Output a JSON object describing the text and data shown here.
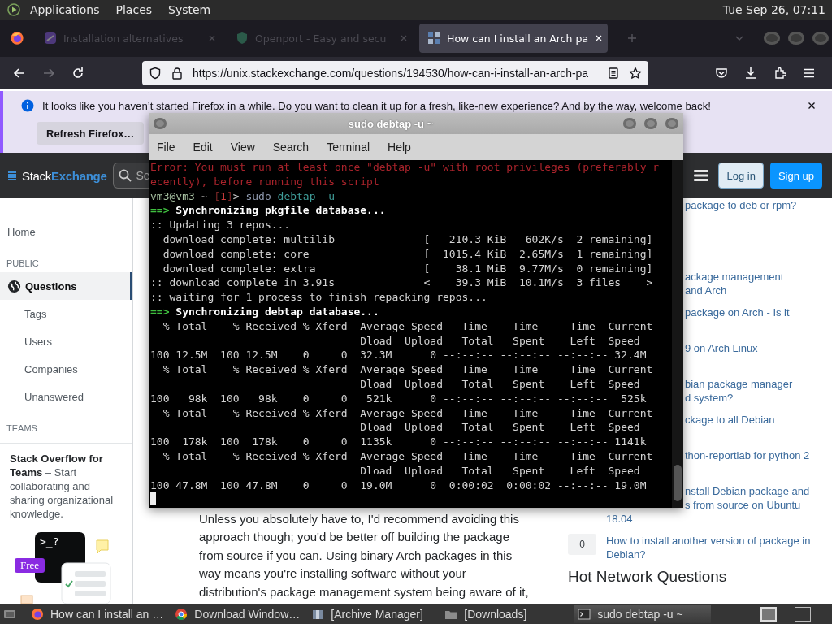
{
  "top_panel": {
    "menus": [
      "Applications",
      "Places",
      "System"
    ],
    "clock": "Tue Sep 26, 07:11"
  },
  "browser": {
    "tabs": [
      {
        "title": "Installation alternatives",
        "selected": false
      },
      {
        "title": "Openport - Easy and secu",
        "selected": false
      },
      {
        "title": "How can I install an Arch pa",
        "selected": true
      }
    ],
    "nav_buttons": [
      {
        "kind": "back",
        "disabled": false
      },
      {
        "kind": "forward",
        "disabled": true
      },
      {
        "kind": "reload",
        "disabled": false
      }
    ],
    "url": "https://unix.stackexchange.com/questions/194530/how-can-i-install-an-arch-pa",
    "notification": {
      "message": "It looks like you haven’t started Firefox in a while. Do you want to clean it up for a fresh, like-new experience? And by the way, welcome back!",
      "button": "Refresh Firefox…"
    }
  },
  "site": {
    "logo": {
      "first": "Stack",
      "second": "Exchange"
    },
    "search_placeholder": "Se",
    "login": "Log in",
    "signup": "Sign up",
    "sidebar": [
      {
        "kind": "top",
        "label": "Home",
        "selected": false
      },
      {
        "kind": "heading",
        "label": "PUBLIC"
      },
      {
        "kind": "primary",
        "label": "Questions",
        "selected": true
      },
      {
        "kind": "sub",
        "label": "Tags",
        "selected": false
      },
      {
        "kind": "sub",
        "label": "Users",
        "selected": false
      },
      {
        "kind": "sub",
        "label": "Companies",
        "selected": false
      },
      {
        "kind": "sub",
        "label": "Unanswered",
        "selected": false
      },
      {
        "kind": "heading",
        "label": "TEAMS"
      }
    ],
    "teams": {
      "text": "**Stack Overflow for Teams** – Start collaborating and sharing organizational knowledge.",
      "prompt": ">_?",
      "badge": "Free"
    },
    "answer": {
      "lines": [
        "Unless you absolutely have to, I'd recommend avoiding this",
        "approach though; you'd be better off building the package",
        "from source if you can. Using binary Arch packages in this",
        "way means you're installing software without your",
        "distribution's package management system being aware of it,"
      ]
    },
    "related": [
      {
        "lines": [
          {
            "text": "package to deb or rpm?",
            "cut": true
          }
        ]
      },
      {
        "lines": [
          {
            "text": "ackage management",
            "cut": true
          },
          {
            "text": "and Arch",
            "cut": true
          }
        ]
      },
      {
        "lines": [
          {
            "text": "package on Arch - Is it",
            "cut": true
          }
        ]
      },
      {
        "lines": [
          {
            "text": "9 on Arch Linux",
            "cut": true
          }
        ]
      },
      {
        "lines": [
          {
            "text": "bian package manager",
            "cut": true
          },
          {
            "text": "d system?",
            "cut": true
          }
        ]
      },
      {
        "lines": [
          {
            "text": "ckage to all Debian",
            "cut": true
          }
        ]
      },
      {
        "lines": [
          {
            "text": "thon-reportlab for python 2",
            "cut": true
          }
        ]
      },
      {
        "lines": [
          {
            "text": "nstall Debian package and",
            "cut": true
          },
          {
            "text": "s from source on Ubuntu",
            "cut": true
          },
          {
            "text": "18.04",
            "cut": false
          }
        ]
      },
      {
        "votes": "0",
        "lines": [
          {
            "text": "How to install another version of package in",
            "cut": false
          },
          {
            "text": "Debian?",
            "cut": false
          }
        ]
      }
    ],
    "hot_heading": "Hot Network Questions"
  },
  "terminal": {
    "title": "sudo debtap -u ~",
    "menus": [
      "File",
      "Edit",
      "View",
      "Search",
      "Terminal",
      "Help"
    ],
    "lines": [
      [
        {
          "kind": "error",
          "text": "Error: You must run at least once \"debtap -u\" with root privileges (preferably r"
        }
      ],
      [
        {
          "kind": "error",
          "text": "ecently), before running this script"
        }
      ],
      [
        {
          "kind": "user",
          "text": "vm3@vm3"
        },
        {
          "kind": "path",
          "text": " ~ "
        },
        {
          "kind": "bracket",
          "text": "["
        },
        {
          "kind": "status",
          "text": "1"
        },
        {
          "kind": "bracket",
          "text": "]"
        },
        {
          "kind": "prompt",
          "text": "> "
        },
        {
          "kind": "cmd",
          "text": "sudo"
        },
        {
          "kind": "arg",
          "text": " debtap -u"
        }
      ],
      [
        {
          "kind": "arrow",
          "text": "==> "
        },
        {
          "kind": "bold",
          "text": "Synchronizing pkgfile database..."
        }
      ],
      [
        {
          "kind": "plain",
          "text": ":: Updating 3 repos..."
        }
      ],
      [
        {
          "kind": "plain",
          "text": "  download complete: multilib              [   210.3 KiB   602K/s  2 remaining]"
        }
      ],
      [
        {
          "kind": "plain",
          "text": "  download complete: core                  [  1015.4 KiB  2.65M/s  1 remaining]"
        }
      ],
      [
        {
          "kind": "plain",
          "text": "  download complete: extra                 [    38.1 MiB  9.77M/s  0 remaining]"
        }
      ],
      [
        {
          "kind": "plain",
          "text": ":: download complete in 3.91s              <    39.3 MiB  10.1M/s  3 files    >"
        }
      ],
      [
        {
          "kind": "plain",
          "text": ":: waiting for 1 process to finish repacking repos..."
        }
      ],
      [
        {
          "kind": "arrow",
          "text": "==> "
        },
        {
          "kind": "bold",
          "text": "Synchronizing debtap database..."
        }
      ],
      [
        {
          "kind": "plain",
          "text": "  % Total    % Received % Xferd  Average Speed   Time    Time     Time  Current"
        }
      ],
      [
        {
          "kind": "plain",
          "text": "                                 Dload  Upload   Total   Spent    Left  Speed"
        }
      ],
      [
        {
          "kind": "plain",
          "text": "100 12.5M  100 12.5M    0     0  32.3M      0 --:--:-- --:--:-- --:--:-- 32.4M"
        }
      ],
      [
        {
          "kind": "plain",
          "text": "  % Total    % Received % Xferd  Average Speed   Time    Time     Time  Current"
        }
      ],
      [
        {
          "kind": "plain",
          "text": "                                 Dload  Upload   Total   Spent    Left  Speed"
        }
      ],
      [
        {
          "kind": "plain",
          "text": "100   98k  100   98k    0     0   521k      0 --:--:-- --:--:-- --:--:--  525k"
        }
      ],
      [
        {
          "kind": "plain",
          "text": "  % Total    % Received % Xferd  Average Speed   Time    Time     Time  Current"
        }
      ],
      [
        {
          "kind": "plain",
          "text": "                                 Dload  Upload   Total   Spent    Left  Speed"
        }
      ],
      [
        {
          "kind": "plain",
          "text": "100  178k  100  178k    0     0  1135k      0 --:--:-- --:--:-- --:--:-- 1141k"
        }
      ],
      [
        {
          "kind": "plain",
          "text": "  % Total    % Received % Xferd  Average Speed   Time    Time     Time  Current"
        }
      ],
      [
        {
          "kind": "plain",
          "text": "                                 Dload  Upload   Total   Spent    Left  Speed"
        }
      ],
      [
        {
          "kind": "plain",
          "text": "100 47.8M  100 47.8M    0     0  19.0M      0  0:00:02  0:00:02 --:--:-- 19.0M"
        }
      ]
    ],
    "cursor": true
  },
  "taskbar": [
    {
      "kind": "firefox",
      "label": "How can I install an …",
      "selected": false
    },
    {
      "kind": "chrome",
      "label": "Download Window…",
      "selected": false
    },
    {
      "kind": "archive",
      "label": "[Archive Manager]",
      "selected": false
    },
    {
      "kind": "folder",
      "label": "[Downloads]",
      "selected": false
    },
    {
      "kind": "terminal",
      "label": "sudo debtap -u ~",
      "selected": true
    }
  ]
}
